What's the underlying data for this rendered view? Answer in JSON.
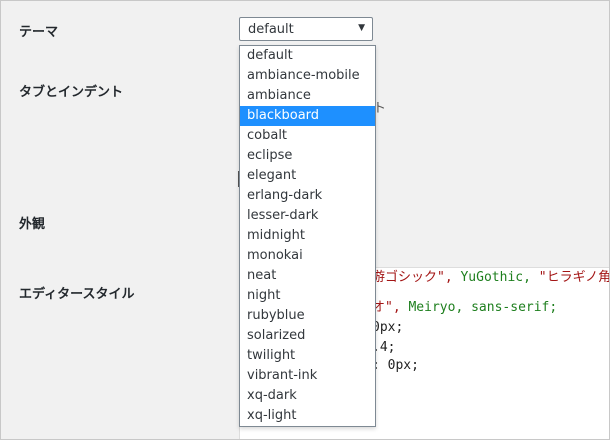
{
  "labels": {
    "theme": "テーマ",
    "tabs": "タブとインデント",
    "appearance": "外観",
    "editor_style": "エディタースタイル"
  },
  "theme_select": {
    "value": "default",
    "options": [
      "default",
      "ambiance-mobile",
      "ambiance",
      "blackboard",
      "cobalt",
      "eclipse",
      "elegant",
      "erlang-dark",
      "lesser-dark",
      "midnight",
      "monokai",
      "neat",
      "night",
      "rubyblue",
      "solarized",
      "twilight",
      "vibrant-ink",
      "xq-dark",
      "xq-light"
    ],
    "highlighted": "blackboard"
  },
  "peek_text": "ト",
  "editor": {
    "line1_str1": "游ゴシック\",",
    "line1_kw": " YuGothic,",
    "line1_str2": " \"ヒラギノ角ゴ",
    "line2_str": "オ\",",
    "line2_kw1": " Meiryo,",
    "line2_kw2": " sans-serif;",
    "line3": "0px;",
    "line4": ".4;",
    "line5": ": 0px;"
  },
  "colors": {
    "highlight": "#1e90ff",
    "string": "#a31515",
    "keyword": "#1e7f1e"
  }
}
